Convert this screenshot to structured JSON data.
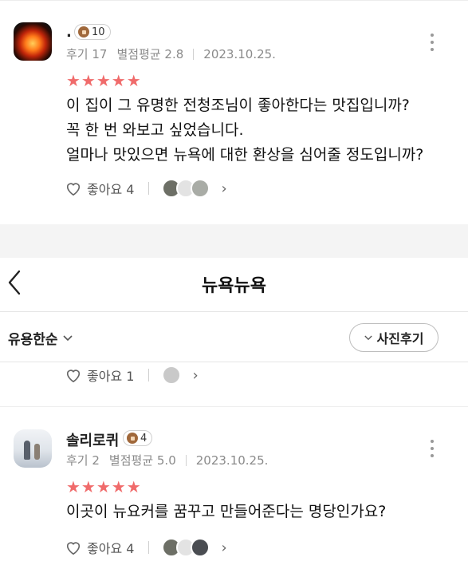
{
  "review1": {
    "name": ".",
    "badge": "10",
    "review_count": "후기 17",
    "rating_avg": "별점평균 2.8",
    "date": "2023.10.25.",
    "stars": "★★★★★",
    "lines": [
      "이 집이 그 유명한 전청조님이 좋아한다는 맛집입니까?",
      "꼭 한 번 와보고 싶었습니다.",
      "얼마나 맛있으면 뉴욕에 대한 환상을 심어줄 정도입니까?"
    ],
    "like_label": "좋아요 4"
  },
  "header": {
    "title": "뉴욕뉴욕"
  },
  "filter": {
    "sort_label": "유용한순",
    "photo_label": "사진후기"
  },
  "partial_review": {
    "like_label": "좋아요 1"
  },
  "review2": {
    "name": "솔리로퀴",
    "badge": "4",
    "review_count": "후기 2",
    "rating_avg": "별점평균 5.0",
    "date": "2023.10.25.",
    "stars": "★★★★★",
    "lines": [
      "이곳이 뉴요커를 꿈꾸고 만들어준다는 명당인가요?"
    ],
    "like_label": "좋아요 4"
  },
  "colors": {
    "star": "#f06b6b",
    "badge_icon": "#a0683b",
    "meta_text": "#8a8a8a"
  }
}
